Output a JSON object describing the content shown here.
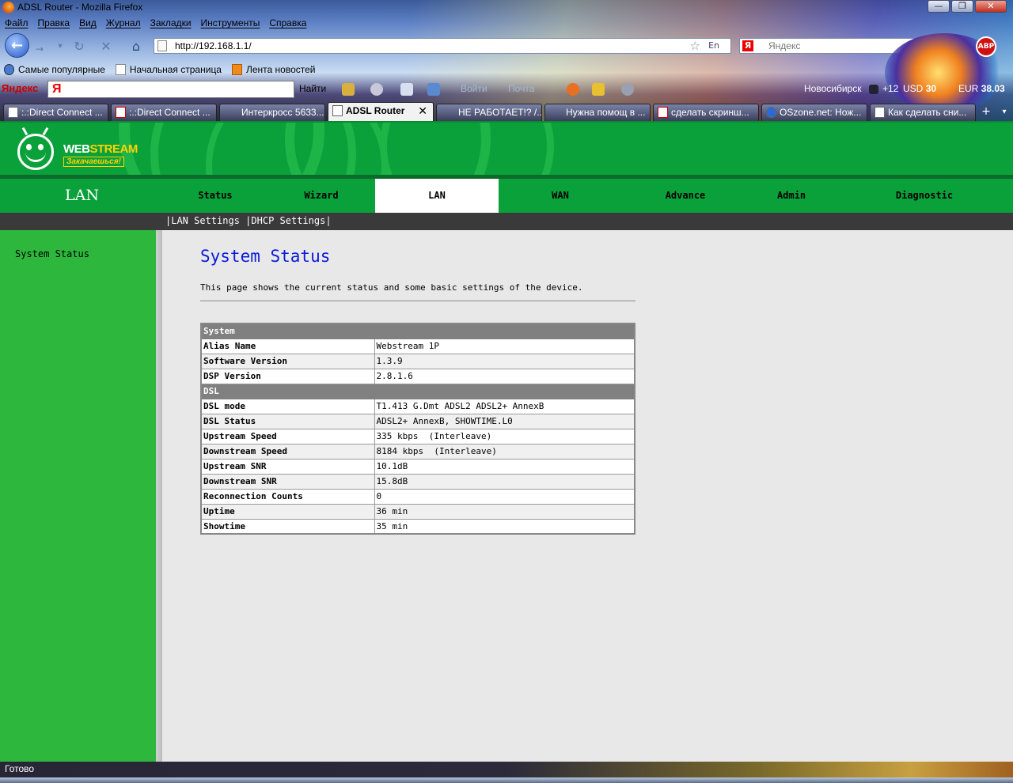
{
  "window": {
    "title": "ADSL Router - Mozilla Firefox"
  },
  "menu": [
    "Файл",
    "Правка",
    "Вид",
    "Журнал",
    "Закладки",
    "Инструменты",
    "Справка"
  ],
  "navigation": {
    "url": "http://192.168.1.1/",
    "lang": "En",
    "search_placeholder": "Яндекс"
  },
  "bookmarks": [
    "Самые популярные",
    "Начальная страница",
    "Лента новостей"
  ],
  "yandex_bar": {
    "logo": "Яндекс",
    "find_label": "Найти",
    "login_label": "Войти",
    "mail_label": "Почта",
    "city": "Новосибирск",
    "temperature": "+12",
    "usd_label": "USD",
    "usd_value": "30",
    "eur_label": "EUR",
    "eur_value": "38.03"
  },
  "tabs": [
    {
      "label": ":.:Direct Connect ...",
      "icon": "page"
    },
    {
      "label": ":.:Direct Connect ...",
      "icon": "hammer-sickle"
    },
    {
      "label": "Интеркросс 5633...",
      "icon": "none"
    },
    {
      "label": "ADSL Router",
      "icon": "page",
      "active": true
    },
    {
      "label": "НЕ РАБОТАЕТ!? /...",
      "icon": "none"
    },
    {
      "label": "Нужна помощ в ...",
      "icon": "none"
    },
    {
      "label": "сделать скринш...",
      "icon": "yandex"
    },
    {
      "label": "OSzone.net: Нож...",
      "icon": "oszone"
    },
    {
      "label": "Как сделать сни...",
      "icon": "page"
    }
  ],
  "router": {
    "brand": {
      "name_a": "WEB",
      "name_b": "STREAM",
      "slogan": "Закачаешься!"
    },
    "section_title": "LAN",
    "nav": [
      "Status",
      "Wizard",
      "LAN",
      "WAN",
      "Advance",
      "Admin",
      "Diagnostic"
    ],
    "active_nav": "LAN",
    "subnav": {
      "sep1": "|",
      "lan_settings": "LAN Settings",
      "sep2": "|",
      "dhcp_settings": "DHCP Settings",
      "sep3": "|"
    },
    "sidebar": {
      "system_status": "System Status"
    },
    "page": {
      "heading": "System Status",
      "description": "This page shows the current status and some basic settings of the device."
    },
    "table": {
      "system_header": "System",
      "system_rows": [
        {
          "key": "Alias Name",
          "value": "Webstream 1P"
        },
        {
          "key": "Software Version",
          "value": "1.3.9"
        },
        {
          "key": "DSP Version",
          "value": "2.8.1.6"
        }
      ],
      "dsl_header": "DSL",
      "dsl_rows": [
        {
          "key": "DSL mode",
          "value": "T1.413 G.Dmt ADSL2 ADSL2+ AnnexB"
        },
        {
          "key": "DSL Status",
          "value": "ADSL2+ AnnexB, SHOWTIME.L0"
        },
        {
          "key": "Upstream Speed",
          "value": "335 kbps  (Interleave)"
        },
        {
          "key": "Downstream Speed",
          "value": "8184 kbps  (Interleave)"
        },
        {
          "key": "Upstream SNR",
          "value": "10.1dB"
        },
        {
          "key": "Downstream SNR",
          "value": "15.8dB"
        },
        {
          "key": "Reconnection Counts",
          "value": "0"
        },
        {
          "key": "Uptime",
          "value": "36 min"
        },
        {
          "key": "Showtime",
          "value": "35 min"
        }
      ]
    }
  },
  "statusbar": {
    "text": "Готово"
  },
  "colors": {
    "brand_green": "#0aa13b",
    "sidebar_green": "#2db83d",
    "heading_blue": "#0a1ad8",
    "subnav_dark": "#3a3a3a"
  }
}
